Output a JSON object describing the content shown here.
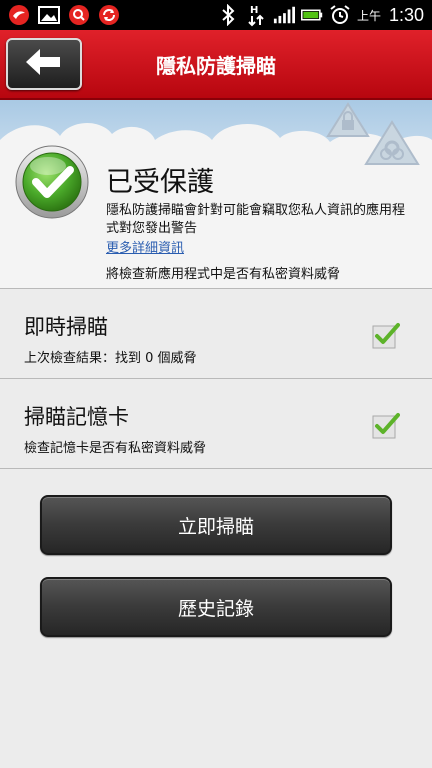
{
  "status_bar": {
    "ampm": "上午",
    "time": "1:30",
    "icons": [
      "trend-micro-icon",
      "image-icon",
      "search-icon",
      "sync-icon",
      "bluetooth-icon",
      "data-transfer-icon",
      "signal-icon",
      "battery-icon",
      "alarm-icon"
    ]
  },
  "header": {
    "title": "隱私防護掃瞄",
    "back_icon": "back-arrow-icon"
  },
  "info": {
    "status_title": "已受保護",
    "description": "隱私防護掃瞄會針對可能會竊取您私人資訊的應用程式對您發出警告",
    "more_link": "更多詳細資訊",
    "check_new_apps": "將檢查新應用程式中是否有私密資料威脅"
  },
  "options": [
    {
      "title": "即時掃瞄",
      "subtitle": "上次檢查結果：找到 0 個威脅",
      "checked": true
    },
    {
      "title": "掃瞄記憶卡",
      "subtitle": "檢查記憶卡是否有私密資料威脅",
      "checked": true
    }
  ],
  "buttons": {
    "scan_now": "立即掃瞄",
    "history": "歷史記錄"
  },
  "colors": {
    "header_red": "#d0121c",
    "check_green": "#5db32a",
    "link_blue": "#2a5db0"
  }
}
